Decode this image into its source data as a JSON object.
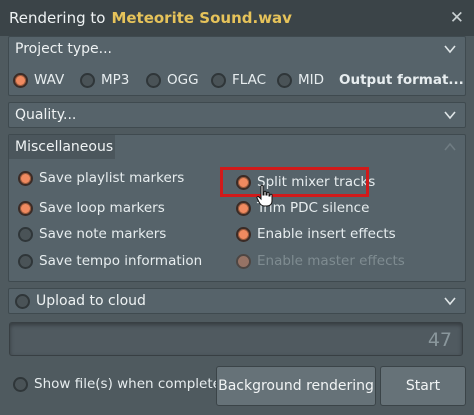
{
  "window": {
    "title_prefix": "Rendering to",
    "file_name": "Meteorite Sound.wav"
  },
  "project_type": {
    "label": "Project type...",
    "formats": [
      {
        "label": "WAV",
        "selected": true
      },
      {
        "label": "MP3",
        "selected": false
      },
      {
        "label": "OGG",
        "selected": false
      },
      {
        "label": "FLAC",
        "selected": false
      },
      {
        "label": "MID",
        "selected": false
      }
    ],
    "output_format_label": "Output format..."
  },
  "quality": {
    "label": "Quality..."
  },
  "misc": {
    "label": "Miscellaneous",
    "options": {
      "save_playlist_markers": "Save playlist markers",
      "save_loop_markers": "Save loop markers",
      "save_note_markers": "Save note markers",
      "save_tempo_information": "Save tempo information",
      "split_mixer_tracks": "Split mixer tracks",
      "trim_pdc_silence": "Trim PDC silence",
      "enable_insert_effects": "Enable insert effects",
      "enable_master_effects": "Enable master effects"
    }
  },
  "upload": {
    "label": "Upload to cloud"
  },
  "progress": {
    "value": "47"
  },
  "footer": {
    "show_files_label": "Show file(s) when complete",
    "background_rendering_label": "Background rendering",
    "start_label": "Start"
  },
  "colors": {
    "accent_radio": "#f08a60",
    "file_name": "#e6c35a",
    "highlight": "#d11a1a"
  }
}
